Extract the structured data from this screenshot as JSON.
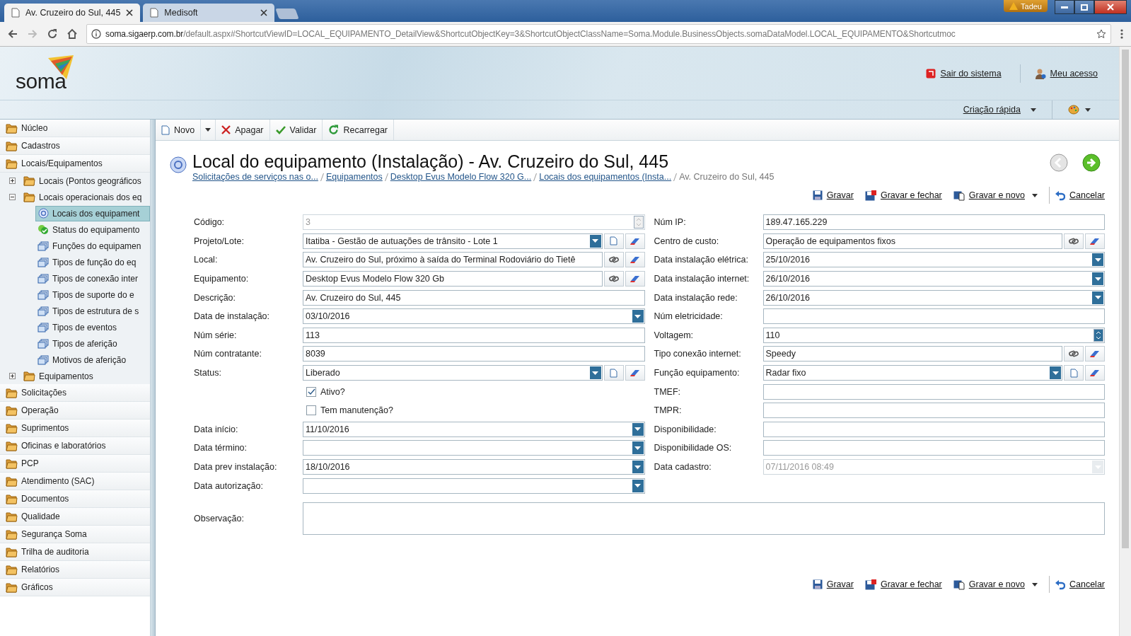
{
  "browser": {
    "tabs": [
      {
        "title": "Av. Cruzeiro do Sul, 445",
        "selected": true
      },
      {
        "title": "Medisoft",
        "selected": false
      }
    ],
    "user": "Tadeu",
    "url_host": "soma.sigaerp.com.br",
    "url_path": "/default.aspx#ShortcutViewID=LOCAL_EQUIPAMENTO_DetailView&ShortcutObjectKey=3&ShortcutObjectClassName=Soma.Module.BusinessObjects.somaDataModel.LOCAL_EQUIPAMENTO&Shortcutmoc"
  },
  "header": {
    "logo": "soma",
    "links": [
      {
        "label": "Sair do sistema",
        "kind": "exit"
      },
      {
        "label": "Meu acesso",
        "kind": "user"
      }
    ],
    "quick_create": "Criação rápida"
  },
  "sidebar": {
    "items": [
      {
        "label": "Núcleo",
        "kind": "folder",
        "selected": false
      },
      {
        "label": "Cadastros",
        "kind": "folder",
        "selected": false
      },
      {
        "label": "Locais/Equipamentos",
        "kind": "folder",
        "selected": false,
        "children": [
          {
            "label": "Locais (Pontos geográficos",
            "kind": "folder",
            "selected": false,
            "expanded": false
          },
          {
            "label": "Locais operacionais dos eq",
            "kind": "folder",
            "selected": false,
            "expanded": true,
            "children": [
              {
                "label": "Locais dos equipament",
                "kind": "view",
                "selected": true
              },
              {
                "label": "Status do equipamento",
                "kind": "status",
                "selected": false
              },
              {
                "label": "Funções do equipamen",
                "kind": "list",
                "selected": false
              },
              {
                "label": "Tipos de função do eq",
                "kind": "list",
                "selected": false
              },
              {
                "label": "Tipos de conexão inter",
                "kind": "list",
                "selected": false
              },
              {
                "label": "Tipos de suporte do e",
                "kind": "list",
                "selected": false
              },
              {
                "label": "Tipos de estrutura de s",
                "kind": "list",
                "selected": false
              },
              {
                "label": "Tipos de eventos",
                "kind": "list",
                "selected": false
              },
              {
                "label": "Tipos de aferição",
                "kind": "list",
                "selected": false
              },
              {
                "label": "Motivos de aferição",
                "kind": "list",
                "selected": false
              }
            ]
          },
          {
            "label": "Equipamentos",
            "kind": "folder",
            "selected": false,
            "expanded": false
          }
        ]
      },
      {
        "label": "Solicitações",
        "kind": "folder",
        "selected": false
      },
      {
        "label": "Operação",
        "kind": "folder",
        "selected": false
      },
      {
        "label": "Suprimentos",
        "kind": "folder",
        "selected": false
      },
      {
        "label": "Oficinas e laboratórios",
        "kind": "folder",
        "selected": false
      },
      {
        "label": "PCP",
        "kind": "folder",
        "selected": false
      },
      {
        "label": "Atendimento (SAC)",
        "kind": "folder",
        "selected": false
      },
      {
        "label": "Documentos",
        "kind": "folder",
        "selected": false
      },
      {
        "label": "Qualidade",
        "kind": "folder",
        "selected": false
      },
      {
        "label": "Segurança Soma",
        "kind": "folder",
        "selected": false
      },
      {
        "label": "Trilha de auditoria",
        "kind": "folder",
        "selected": false
      },
      {
        "label": "Relatórios",
        "kind": "folder",
        "selected": false
      },
      {
        "label": "Gráficos",
        "kind": "folder",
        "selected": false
      }
    ]
  },
  "toolbar": [
    {
      "label": "Novo",
      "kind": "new"
    },
    {
      "label": "Apagar",
      "kind": "delete"
    },
    {
      "label": "Validar",
      "kind": "validate"
    },
    {
      "label": "Recarregar",
      "kind": "reload"
    }
  ],
  "title": "Local do equipamento (Instalação) - Av. Cruzeiro do Sul, 445",
  "breadcrumb": [
    {
      "label": "Solicitações de serviços nas o...",
      "link": true
    },
    {
      "label": "Equipamentos",
      "link": true
    },
    {
      "label": "Desktop Evus Modelo Flow 320 G...",
      "link": true
    },
    {
      "label": "Locais dos equipamentos (Insta...",
      "link": true
    },
    {
      "label": "Av. Cruzeiro do Sul, 445",
      "link": false
    }
  ],
  "actions_top": [
    {
      "label": "Gravar",
      "kind": "save"
    },
    {
      "label": "Gravar e fechar",
      "kind": "save-close"
    },
    {
      "label": "Gravar e novo",
      "kind": "save-new"
    },
    {
      "label": "Cancelar",
      "kind": "cancel"
    }
  ],
  "form": {
    "left": [
      {
        "label": "Código:",
        "value": "3",
        "kind": "spin",
        "disabled": true
      },
      {
        "label": "Projeto/Lote:",
        "value": "Itatiba - Gestão de autuações de trânsito - Lote 1",
        "kind": "combo",
        "disabled": false
      },
      {
        "label": "Local:",
        "value": "Av. Cruzeiro do Sul, próximo à saída do Terminal Rodoviário do Tietê",
        "kind": "lookup",
        "disabled": false
      },
      {
        "label": "Equipamento:",
        "value": "Desktop Evus Modelo Flow 320 Gb",
        "kind": "lookup",
        "disabled": false
      },
      {
        "label": "Descrição:",
        "value": "Av. Cruzeiro do Sul, 445",
        "kind": "text",
        "disabled": false
      },
      {
        "label": "Data de instalação:",
        "value": "03/10/2016",
        "kind": "date",
        "disabled": false
      },
      {
        "label": "Núm série:",
        "value": "113",
        "kind": "text",
        "disabled": false
      },
      {
        "label": "Núm contratante:",
        "value": "8039",
        "kind": "text",
        "disabled": false
      },
      {
        "label": "Status:",
        "value": "Liberado",
        "kind": "combo",
        "disabled": false
      },
      {
        "label": "Ativo?",
        "kind": "checkbox",
        "checked": true,
        "disabled": false
      },
      {
        "label": "Tem manutenção?",
        "kind": "checkbox",
        "checked": false,
        "disabled": false
      },
      {
        "label": "Data início:",
        "value": "11/10/2016",
        "kind": "date",
        "disabled": false
      },
      {
        "label": "Data término:",
        "kind": "date",
        "disabled": false
      },
      {
        "label": "Data prev instalação:",
        "value": "18/10/2016",
        "kind": "date",
        "disabled": false
      },
      {
        "label": "Data autorização:",
        "kind": "date",
        "disabled": false
      }
    ],
    "right": [
      {
        "label": "Núm IP:",
        "value": "189.47.165.229",
        "kind": "text",
        "disabled": false
      },
      {
        "label": "Centro de custo:",
        "value": "Operação de equipamentos fixos",
        "kind": "lookup",
        "disabled": false
      },
      {
        "label": "Data instalação elétrica:",
        "value": "25/10/2016",
        "kind": "date",
        "disabled": false
      },
      {
        "label": "Data instalação internet:",
        "value": "26/10/2016",
        "kind": "date",
        "disabled": false
      },
      {
        "label": "Data instalação rede:",
        "value": "26/10/2016",
        "kind": "date",
        "disabled": false
      },
      {
        "label": "Núm eletricidade:",
        "kind": "text",
        "disabled": false
      },
      {
        "label": "Voltagem:",
        "value": "110",
        "kind": "spin",
        "disabled": false
      },
      {
        "label": "Tipo conexão internet:",
        "value": "Speedy",
        "kind": "lookup",
        "disabled": false
      },
      {
        "label": "Função equipamento:",
        "value": "Radar fixo",
        "kind": "combo",
        "disabled": false
      },
      {
        "label": "TMEF:",
        "kind": "text",
        "disabled": false
      },
      {
        "label": "TMPR:",
        "kind": "text",
        "disabled": false
      },
      {
        "label": "Disponibilidade:",
        "kind": "text",
        "disabled": false
      },
      {
        "label": "Disponibilidade OS:",
        "kind": "text",
        "disabled": false
      },
      {
        "label": "Data cadastro:",
        "value": "07/11/2016 08:49",
        "kind": "date",
        "disabled": true
      }
    ],
    "notes": {
      "label": "Observação:"
    }
  },
  "actions_bottom": [
    {
      "label": "Gravar",
      "kind": "save"
    },
    {
      "label": "Gravar e fechar",
      "kind": "save-close"
    },
    {
      "label": "Gravar e novo",
      "kind": "save-new"
    },
    {
      "label": "Cancelar",
      "kind": "cancel"
    }
  ]
}
